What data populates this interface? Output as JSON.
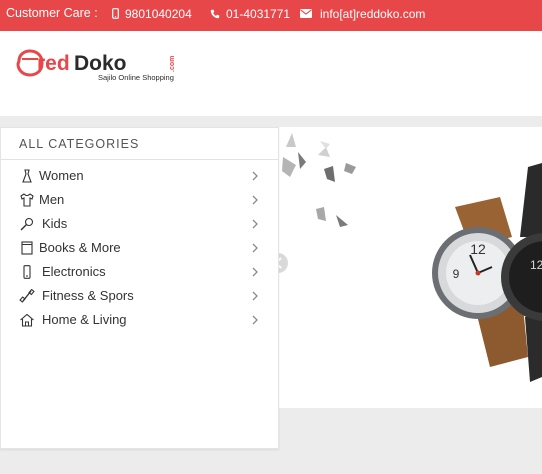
{
  "topbar": {
    "customer_care_label": "Customer Care :",
    "phone_mobile": "9801040204",
    "phone_landline": "01-4031771",
    "email": "info[at]reddoko.com"
  },
  "brand": {
    "logo_text_red": "red",
    "logo_text_dark": "Doko",
    "logo_domain": ".com",
    "tagline": "Sajilo Online Shopping"
  },
  "categories": {
    "title": "ALL CATEGORIES",
    "items": [
      {
        "label": "Women",
        "icon": "dress-icon"
      },
      {
        "label": "Men",
        "icon": "tshirt-icon"
      },
      {
        "label": "Kids",
        "icon": "rattle-icon"
      },
      {
        "label": "Books & More",
        "icon": "book-icon"
      },
      {
        "label": "Electronics",
        "icon": "mobile-icon"
      },
      {
        "label": "Fitness & Spors",
        "icon": "dumbbell-icon"
      },
      {
        "label": "Home & Living",
        "icon": "home-icon"
      }
    ]
  },
  "colors": {
    "brand_red": "#e8474a",
    "dark": "#2b2b2b"
  }
}
